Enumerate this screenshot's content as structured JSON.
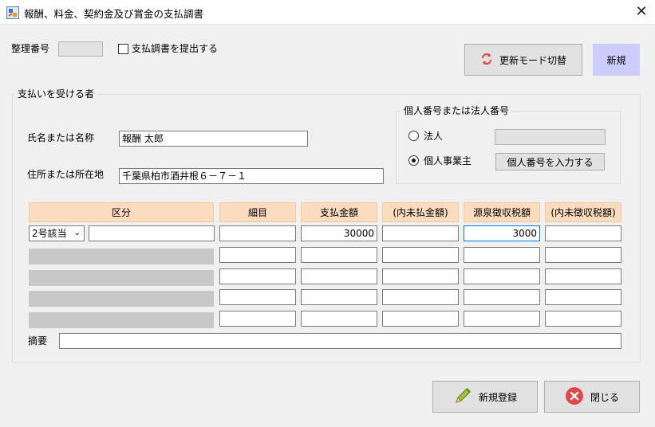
{
  "window": {
    "title": "報酬、料金、契約金及び賞金の支払調書"
  },
  "header": {
    "seiri_label": "整理番号",
    "seiri_value": "",
    "submit_checkbox_label": "支払調書を提出する",
    "submit_checked": false,
    "mode_button_label": "更新モード切替",
    "new_button_label": "新規"
  },
  "payee": {
    "group_title": "支払いを受ける者",
    "name_label": "氏名または名称",
    "name_value": "報酬 太郎",
    "address_label": "住所または所在地",
    "address_value": "千葉県柏市酒井根６－７－１",
    "number_group_title": "個人番号または法人番号",
    "corp_label": "法人",
    "corp_value": "",
    "individual_label": "個人事業主",
    "selected": "個人事業主",
    "input_number_button": "個人番号を入力する"
  },
  "table": {
    "headers": [
      "区分",
      "細目",
      "支払金額",
      "(内未払金額)",
      "源泉徴収税額",
      "(内未徴収税額)"
    ],
    "rows": [
      {
        "kubun_select": "2号該当",
        "kubun_text": "",
        "saimoku": "",
        "shiharai": "30000",
        "mibarai": "",
        "gensen": "3000",
        "michoshu": ""
      },
      {
        "kubun_select": "",
        "kubun_text": "",
        "saimoku": "",
        "shiharai": "",
        "mibarai": "",
        "gensen": "",
        "michoshu": ""
      },
      {
        "kubun_select": "",
        "kubun_text": "",
        "saimoku": "",
        "shiharai": "",
        "mibarai": "",
        "gensen": "",
        "michoshu": ""
      },
      {
        "kubun_select": "",
        "kubun_text": "",
        "saimoku": "",
        "shiharai": "",
        "mibarai": "",
        "gensen": "",
        "michoshu": ""
      },
      {
        "kubun_select": "",
        "kubun_text": "",
        "saimoku": "",
        "shiharai": "",
        "mibarai": "",
        "gensen": "",
        "michoshu": ""
      }
    ],
    "tekiyo_label": "摘要",
    "tekiyo_value": ""
  },
  "footer": {
    "register_label": "新規登録",
    "close_label": "閉じる"
  },
  "colors": {
    "header_bg": "#fcdcbf",
    "new_button_bg": "#ccccff",
    "close_icon": "#e04747"
  }
}
